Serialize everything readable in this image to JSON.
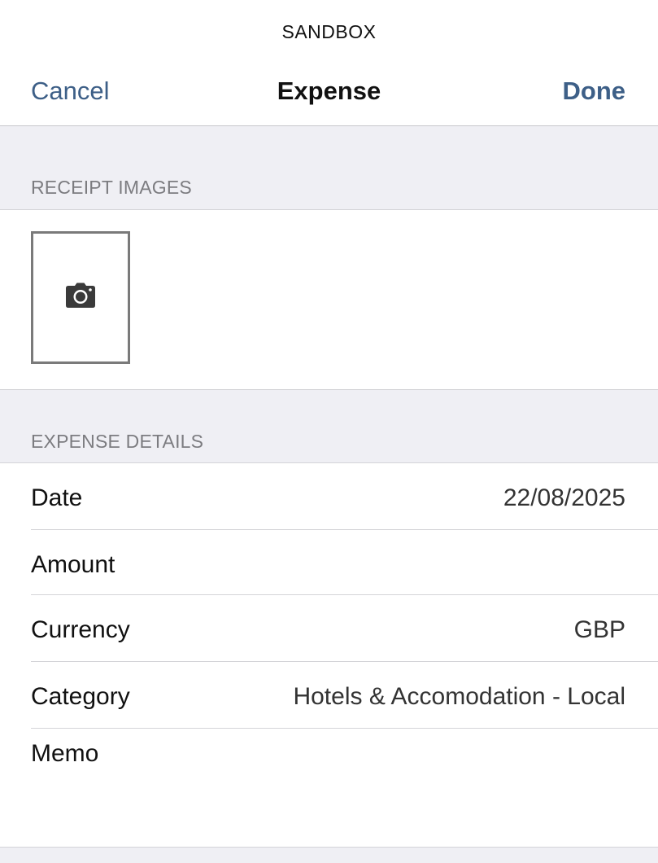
{
  "environment_label": "SANDBOX",
  "navbar": {
    "cancel_label": "Cancel",
    "title": "Expense",
    "done_label": "Done",
    "accent_color": "#3d5f87"
  },
  "receipt_section": {
    "header": "RECEIPT IMAGES",
    "add_icon": "camera-icon"
  },
  "details_section": {
    "header": "EXPENSE DETAILS",
    "rows": [
      {
        "label": "Date",
        "value": "22/08/2025"
      },
      {
        "label": "Amount",
        "value": ""
      },
      {
        "label": "Currency",
        "value": "GBP"
      },
      {
        "label": "Category",
        "value": "Hotels & Accomodation - Local"
      },
      {
        "label": "Memo",
        "value": ""
      }
    ]
  }
}
